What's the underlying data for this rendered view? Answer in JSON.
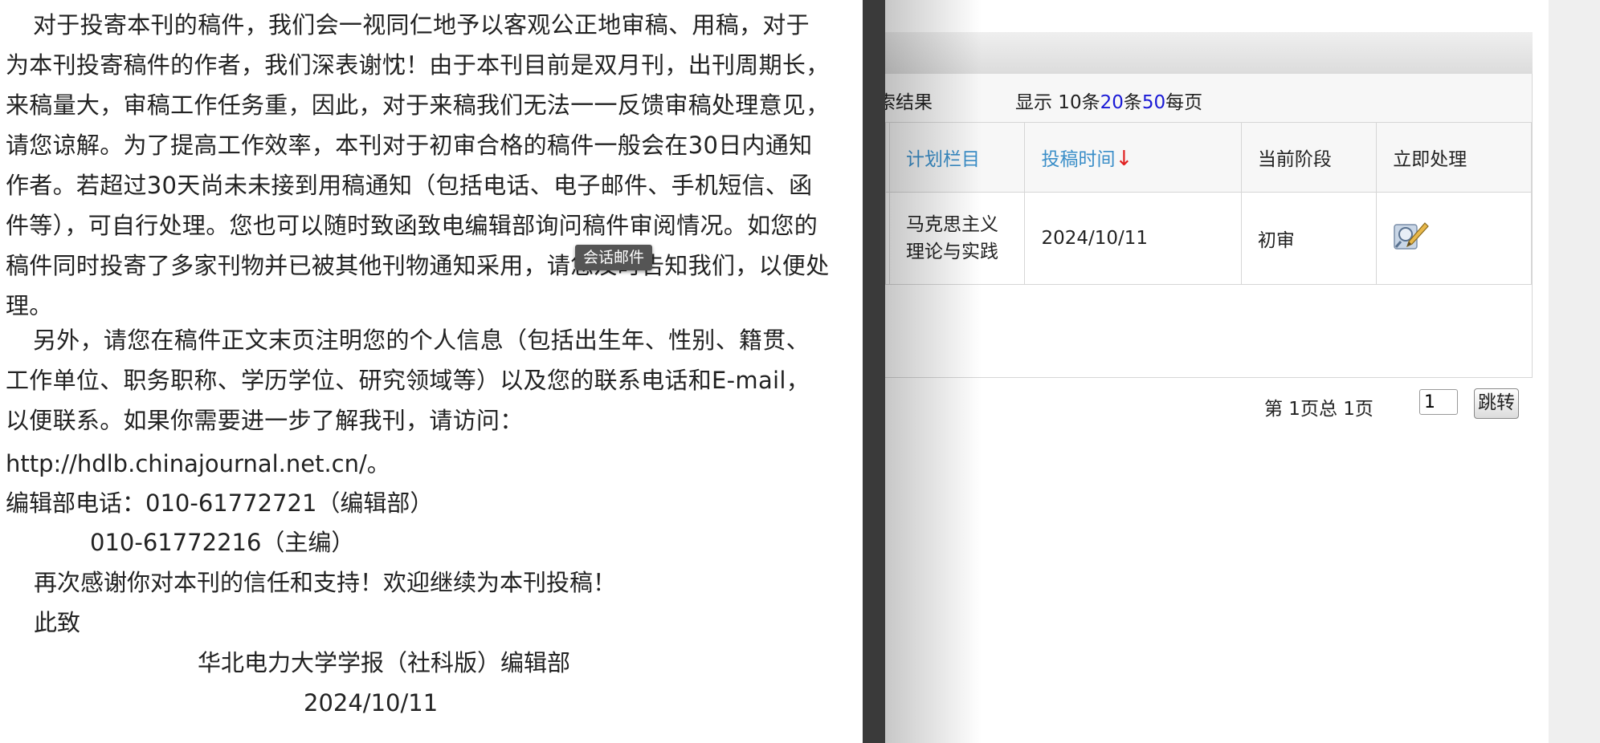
{
  "letter": {
    "paragraph1": "对于投寄本刊的稿件，我们会一视同仁地予以客观公正地审稿、用稿，对于为本刊投寄稿件的作者，我们深表谢忱！由于本刊目前是双月刊，出刊周期长，来稿量大，审稿工作任务重，因此，对于来稿我们无法一一反馈审稿处理意见，请您谅解。为了提高工作效率，本刊对于初审合格的稿件一般会在30日内通知作者。若超过30天尚未未接到用稿通知（包括电话、电子邮件、手机短信、函件等），可自行处理。您也可以随时致函致电编辑部询问稿件审阅情况。如您的稿件同时投寄了多家刊物并已被其他刊物通知采用，请您及时告知我们，以便处理。",
    "paragraph2": "另外，请您在稿件正文末页注明您的个人信息（包括出生年、性别、籍贯、工作单位、职务职称、学历学位、研究领域等）以及您的联系电话和E-mail，以便联系。如果你需要进一步了解我刊，请访问：",
    "url": "http://hdlb.chinajournal.net.cn/。",
    "phone_line1": "编辑部电话：010-61772721（编辑部）",
    "phone_line2": "010-61772216（主编）",
    "thanks": "再次感谢你对本刊的信任和支持！欢迎继续为本刊投稿！",
    "salutation": "此致",
    "signature": "华北电力大学学报（社科版）编辑部",
    "date": "2024/10/11"
  },
  "tooltip": "会话邮件",
  "toolbar": {
    "result_label": "索结果",
    "pagesize_prefix": "显示 10条",
    "pagesize_20": "20",
    "pagesize_mid": "条",
    "pagesize_50": "50",
    "pagesize_suffix": "每页"
  },
  "table": {
    "headers": {
      "plan_column": "计划栏目",
      "submit_time": "投稿时间",
      "sort_arrow": "↓",
      "stage": "当前阶段",
      "action": "立即处理"
    },
    "rows": [
      {
        "plan_column_line1": "马克思主义",
        "plan_column_line2": "理论与实践",
        "submit_time": "2024/10/11",
        "stage": "初审",
        "action_icon": "edit-icon"
      }
    ]
  },
  "pager": {
    "info": "第 1页总 1页",
    "page_value": "1",
    "go_label": "跳转"
  },
  "colors": {
    "link": "#3a8ec8",
    "sort_arrow": "#e02020",
    "pagesize_link": "#1a1ad6",
    "separator": "#3a3a3a"
  }
}
